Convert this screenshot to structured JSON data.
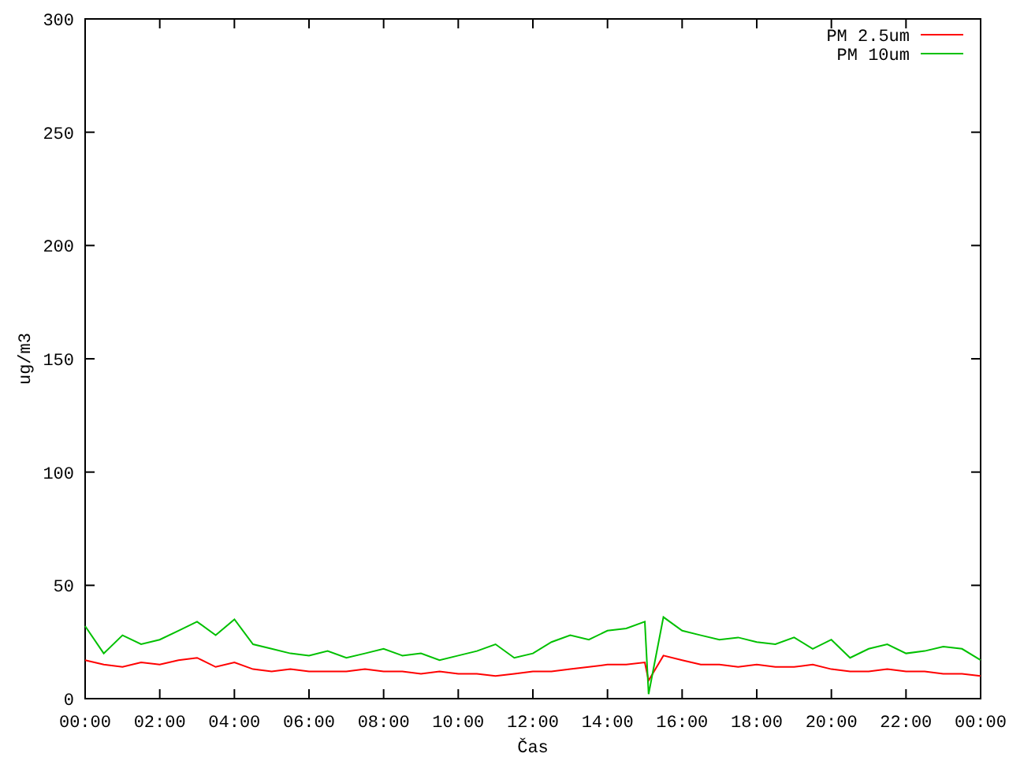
{
  "chart_data": {
    "type": "line",
    "xlabel": "Čas",
    "ylabel": "ug/m3",
    "x": [
      0,
      0.5,
      1,
      1.5,
      2,
      2.5,
      3,
      3.5,
      4,
      4.5,
      5,
      5.5,
      6,
      6.5,
      7,
      7.5,
      8,
      8.5,
      9,
      9.5,
      10,
      10.5,
      11,
      11.5,
      12,
      12.5,
      13,
      13.5,
      14,
      14.5,
      15,
      15.1,
      15.5,
      16,
      16.5,
      17,
      17.5,
      18,
      18.5,
      19,
      19.5,
      20,
      20.5,
      21,
      21.5,
      22,
      22.5,
      23,
      23.5,
      24
    ],
    "series": [
      {
        "name": "PM 2.5um",
        "color": "#ff0000",
        "values": [
          17,
          15,
          14,
          16,
          15,
          17,
          18,
          14,
          16,
          13,
          12,
          13,
          12,
          12,
          12,
          13,
          12,
          12,
          11,
          12,
          11,
          11,
          10,
          11,
          12,
          12,
          13,
          14,
          15,
          15,
          16,
          8,
          19,
          17,
          15,
          15,
          14,
          15,
          14,
          14,
          15,
          13,
          12,
          12,
          13,
          12,
          12,
          11,
          11,
          10
        ]
      },
      {
        "name": "PM 10um",
        "color": "#00c000",
        "values": [
          32,
          20,
          28,
          24,
          26,
          30,
          34,
          28,
          35,
          24,
          22,
          20,
          19,
          21,
          18,
          20,
          22,
          19,
          20,
          17,
          19,
          21,
          24,
          18,
          20,
          25,
          28,
          26,
          30,
          31,
          34,
          2,
          36,
          30,
          28,
          26,
          27,
          25,
          24,
          27,
          22,
          26,
          18,
          22,
          24,
          20,
          21,
          23,
          22,
          17
        ]
      }
    ],
    "xlim": [
      0,
      24
    ],
    "ylim": [
      0,
      300
    ],
    "xticks": [
      {
        "value": 0,
        "label": "00:00"
      },
      {
        "value": 2,
        "label": "02:00"
      },
      {
        "value": 4,
        "label": "04:00"
      },
      {
        "value": 6,
        "label": "06:00"
      },
      {
        "value": 8,
        "label": "08:00"
      },
      {
        "value": 10,
        "label": "10:00"
      },
      {
        "value": 12,
        "label": "12:00"
      },
      {
        "value": 14,
        "label": "14:00"
      },
      {
        "value": 16,
        "label": "16:00"
      },
      {
        "value": 18,
        "label": "18:00"
      },
      {
        "value": 20,
        "label": "20:00"
      },
      {
        "value": 22,
        "label": "22:00"
      },
      {
        "value": 24,
        "label": "00:00"
      }
    ],
    "yticks": [
      0,
      50,
      100,
      150,
      200,
      250,
      300
    ],
    "legend": true
  }
}
